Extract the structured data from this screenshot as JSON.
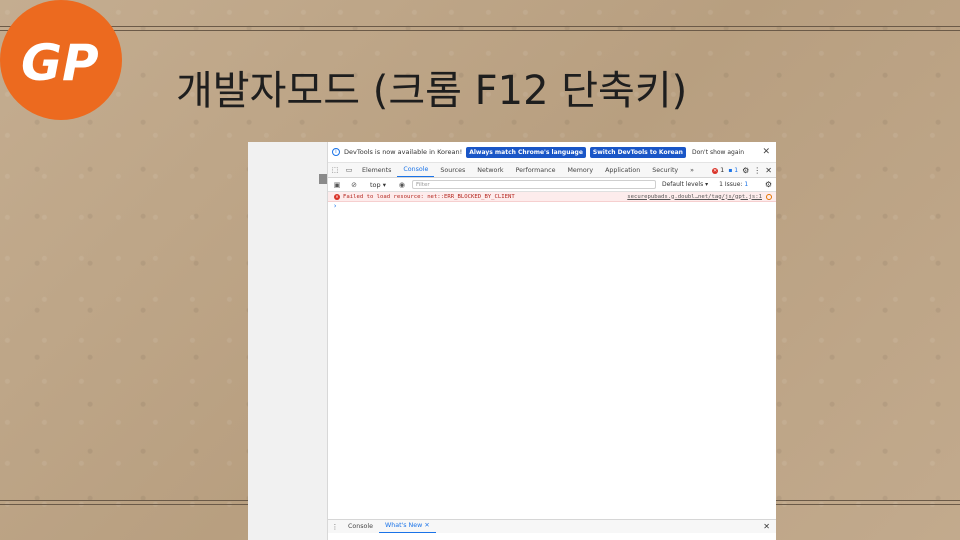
{
  "slide": {
    "title": "개발자모드 (크롬 F12 단축키)",
    "logo_text": "GP",
    "logo_color": "#ec6a1f"
  },
  "devtools": {
    "infobar": {
      "message": "DevTools is now available in Korean!",
      "btn_match": "Always match Chrome's language",
      "btn_switch": "Switch DevTools to Korean",
      "btn_dismiss": "Don't show again",
      "close": "✕"
    },
    "tabs": [
      {
        "label": "Elements"
      },
      {
        "label": "Console"
      },
      {
        "label": "Sources"
      },
      {
        "label": "Network"
      },
      {
        "label": "Performance"
      },
      {
        "label": "Memory"
      },
      {
        "label": "Application"
      },
      {
        "label": "Security"
      }
    ],
    "more_tabs": "»",
    "error_count": "1",
    "message_count": "1",
    "toolbar": {
      "context": "top ▾",
      "filter_placeholder": "Filter",
      "levels": "Default levels ▾",
      "issues": "1 Issue:",
      "issues_count": "1"
    },
    "console": {
      "error_text": "Failed to load resource: net::ERR_BLOCKED_BY_CLIENT",
      "error_source": "securepubads.g.doubl…net/tag/js/gpt.js:1",
      "prompt": "›"
    },
    "drawer": {
      "tab_console": "Console",
      "tab_whats_new": "What's New",
      "tab_close": "✕",
      "close": "✕"
    }
  },
  "colors": {
    "accent": "#1a73e8",
    "error": "#d93025",
    "button_blue": "#1a56c7"
  }
}
